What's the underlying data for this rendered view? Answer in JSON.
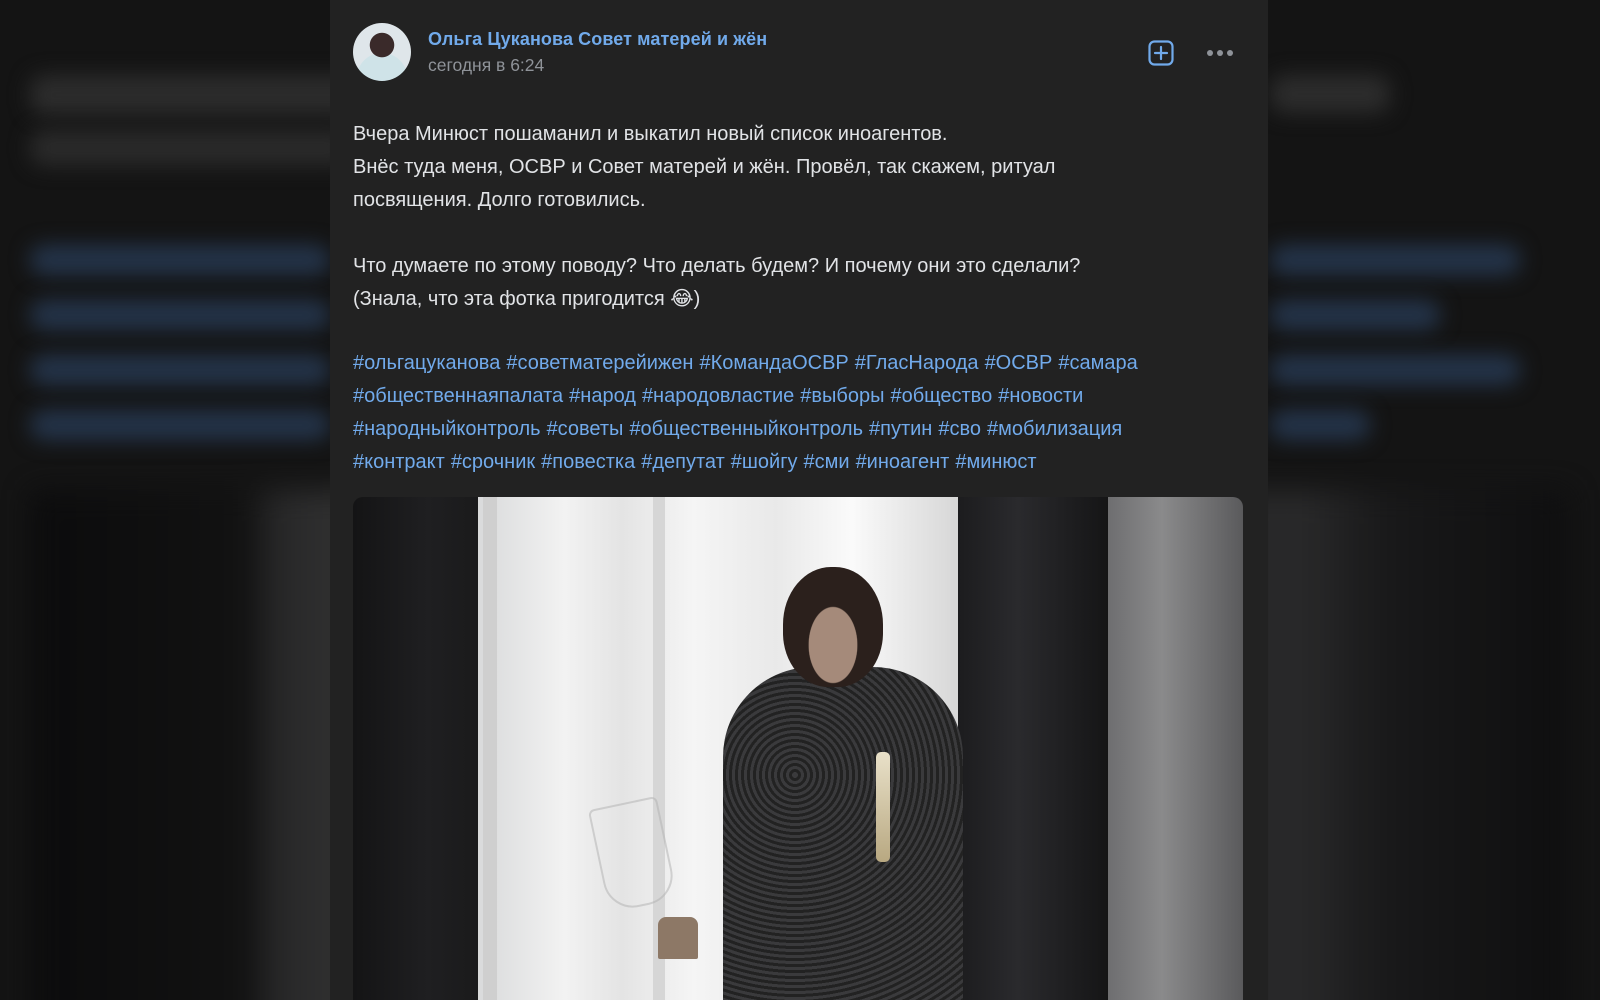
{
  "post": {
    "author": "Ольга Цуканова Совет матерей и жён",
    "time": "сегодня в 6:24",
    "text_lines": [
      "Вчера Минюст пошаманил и выкатил новый список иноагентов.",
      "Внёс туда меня, ОСВР и Совет матерей и жён. Провёл, так скажем, ритуал",
      "посвящения. Долго готовились.",
      "",
      "Что думаете по этому поводу? Что делать будем? И почему они это сделали?",
      "(Знала, что эта фотка пригодится 😂)"
    ],
    "hashtags": [
      "#ольгацуканова",
      "#советматерейижен",
      "#КомандаОСВР",
      "#ГласНарода",
      "#ОСВР",
      "#самара",
      "#общественнаяпалата",
      "#народ",
      "#народовластие",
      "#выборы",
      "#общество",
      "#новости",
      "#народныйконтроль",
      "#советы",
      "#общественныйконтроль",
      "#путин",
      "#сво",
      "#мобилизация",
      "#контракт",
      "#срочник",
      "#повестка",
      "#депутат",
      "#шойгу",
      "#сми",
      "#иноагент",
      "#минюст"
    ]
  },
  "icons": {
    "add": "plus-square-icon",
    "more": "more-horizontal-icon"
  },
  "colors": {
    "accent": "#71aaeb",
    "card": "#222222",
    "text": "#e1e3e6",
    "muted": "#8f9399"
  }
}
